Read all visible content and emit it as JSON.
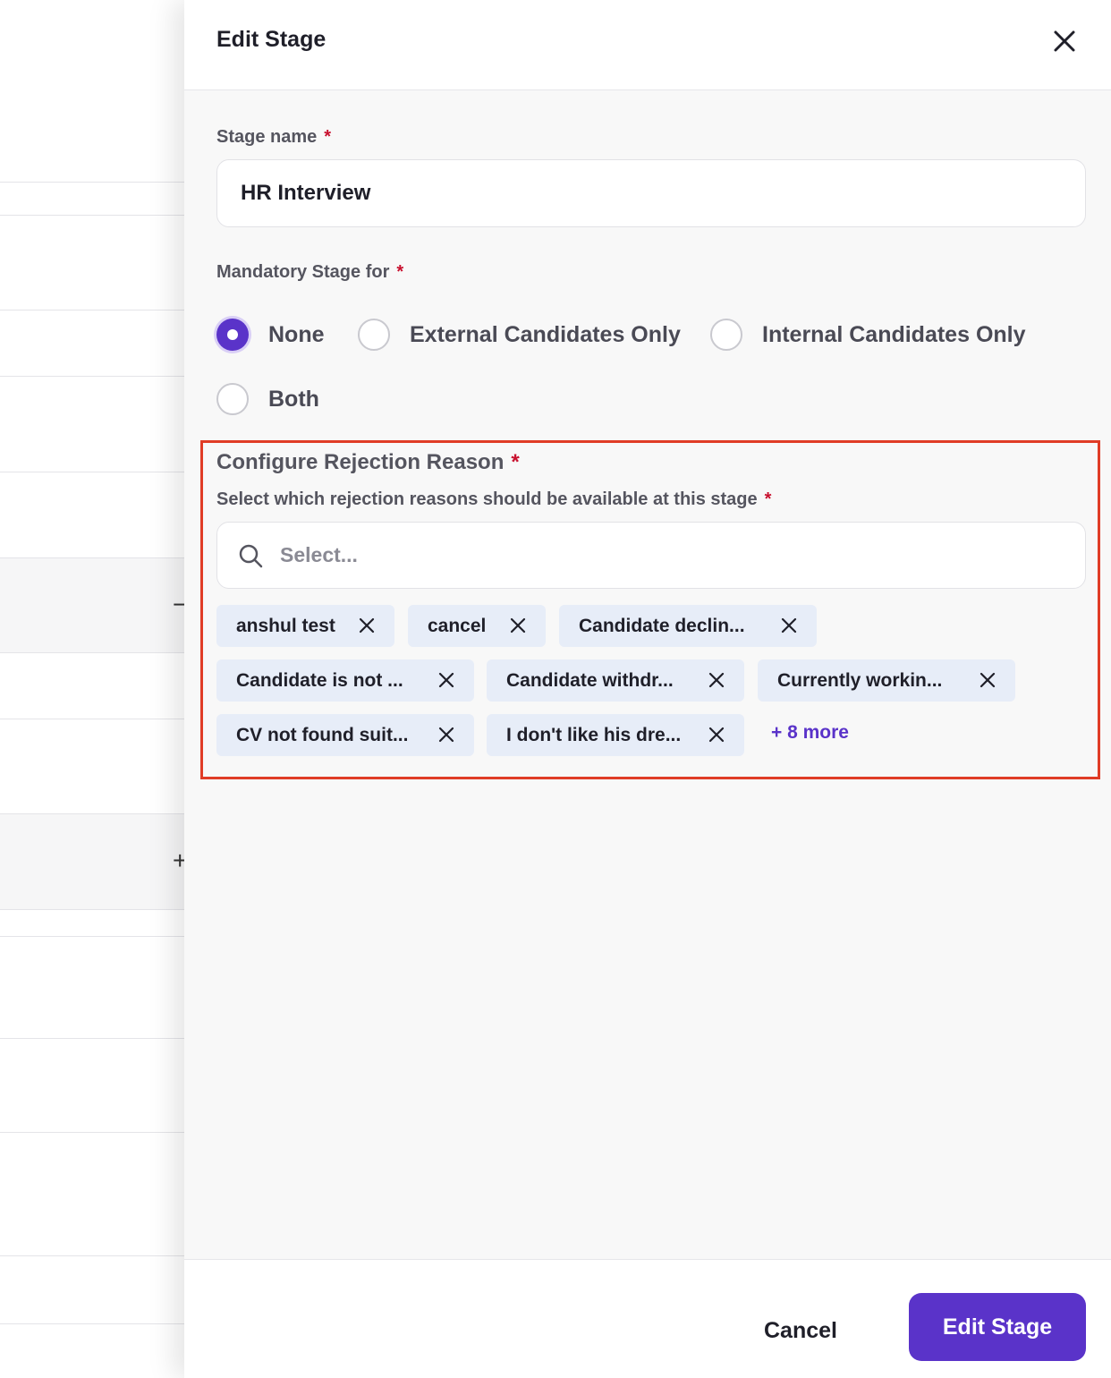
{
  "drawer": {
    "title": "Edit Stage",
    "close_icon": "close-icon"
  },
  "stage_name": {
    "label": "Stage name",
    "required_mark": "*",
    "value": "HR Interview"
  },
  "mandatory": {
    "label": "Mandatory Stage for",
    "required_mark": "*",
    "options": [
      {
        "label": "None",
        "checked": true
      },
      {
        "label": "External Candidates Only",
        "checked": false
      },
      {
        "label": "Internal Candidates Only",
        "checked": false
      },
      {
        "label": "Both",
        "checked": false
      }
    ]
  },
  "rejection": {
    "title": "Configure Rejection Reason",
    "title_required_mark": "*",
    "subtitle": "Select which rejection reasons should be available at this stage",
    "subtitle_required_mark": "*",
    "search_placeholder": "Select...",
    "search_icon": "search-icon",
    "tags": [
      "anshul test",
      "cancel",
      "Candidate declin...",
      "Candidate is not ...",
      "Candidate withdr...",
      "Currently workin...",
      "CV not found suit...",
      "I don't like his dre..."
    ],
    "more_label": "+ 8 more"
  },
  "footer": {
    "cancel_label": "Cancel",
    "submit_label": "Edit Stage"
  },
  "colors": {
    "accent": "#5a33c9",
    "tag_bg": "#e7edf8",
    "required": "#c8102e",
    "highlight": "#e03c26"
  }
}
